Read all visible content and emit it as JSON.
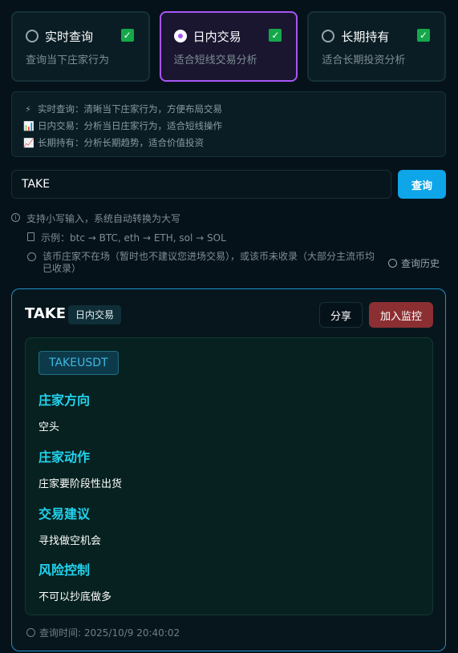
{
  "modes": [
    {
      "title": "实时查询",
      "desc": "查询当下庄家行为",
      "selected": false,
      "checked": true
    },
    {
      "title": "日内交易",
      "desc": "适合短线交易分析",
      "selected": true,
      "checked": true
    },
    {
      "title": "长期持有",
      "desc": "适合长期投资分析",
      "selected": false,
      "checked": true
    }
  ],
  "info": {
    "lines": [
      {
        "icon": "⚡",
        "text": "实时查询：清晰当下庄家行为，方便布局交易"
      },
      {
        "icon": "📊",
        "text": "日内交易：分析当日庄家行为，适合短线操作"
      },
      {
        "icon": "📈",
        "text": "长期持有：分析长期趋势，适合价值投资"
      }
    ]
  },
  "search": {
    "value": "TAKE",
    "button_label": "查询"
  },
  "hints": {
    "line1": "支持小写输入，系统自动转换为大写",
    "line2": "示例：btc → BTC, eth → ETH, sol → SOL",
    "line3": "该币庄家不在场（暂时也不建议您进场交易），或该币未收录（大部分主流币均已收录）",
    "history_link": "查询历史"
  },
  "result": {
    "symbol": "TAKE",
    "mode_tag": "日内交易",
    "share_label": "分享",
    "monitor_label": "加入监控",
    "pair": "TAKEUSDT",
    "sections": [
      {
        "heading": "庄家方向",
        "value": "空头"
      },
      {
        "heading": "庄家动作",
        "value": "庄家要阶段性出货"
      },
      {
        "heading": "交易建议",
        "value": "寻找做空机会"
      },
      {
        "heading": "风险控制",
        "value": "不可以抄底做多"
      }
    ],
    "query_time": "查询时间: 2025/10/9 20:40:02"
  },
  "colors": {
    "accent_purple": "#a855f7",
    "accent_cyan": "#22d3ee",
    "button_blue": "#0ea5e9",
    "monitor_red": "#8b2f33",
    "check_green": "#15a84a"
  }
}
